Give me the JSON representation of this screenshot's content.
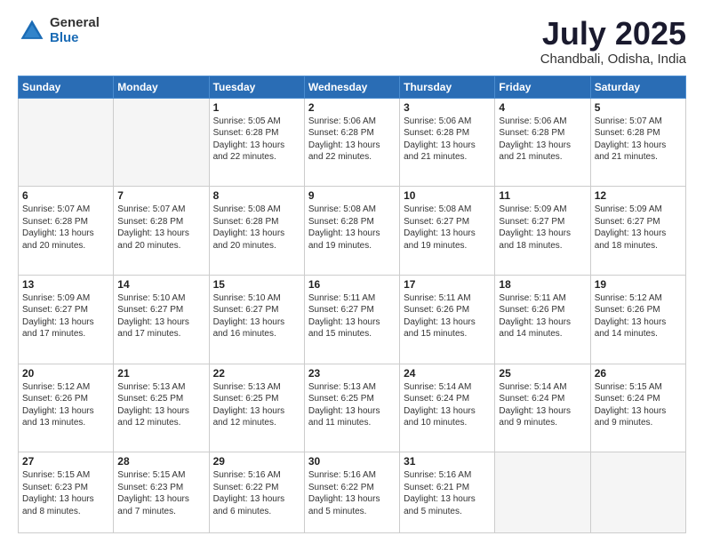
{
  "header": {
    "logo_general": "General",
    "logo_blue": "Blue",
    "month_title": "July 2025",
    "location": "Chandbali, Odisha, India"
  },
  "weekdays": [
    "Sunday",
    "Monday",
    "Tuesday",
    "Wednesday",
    "Thursday",
    "Friday",
    "Saturday"
  ],
  "days": [
    {
      "num": "",
      "empty": true
    },
    {
      "num": "",
      "empty": true
    },
    {
      "num": "1",
      "sunrise": "Sunrise: 5:05 AM",
      "sunset": "Sunset: 6:28 PM",
      "daylight": "Daylight: 13 hours and 22 minutes."
    },
    {
      "num": "2",
      "sunrise": "Sunrise: 5:06 AM",
      "sunset": "Sunset: 6:28 PM",
      "daylight": "Daylight: 13 hours and 22 minutes."
    },
    {
      "num": "3",
      "sunrise": "Sunrise: 5:06 AM",
      "sunset": "Sunset: 6:28 PM",
      "daylight": "Daylight: 13 hours and 21 minutes."
    },
    {
      "num": "4",
      "sunrise": "Sunrise: 5:06 AM",
      "sunset": "Sunset: 6:28 PM",
      "daylight": "Daylight: 13 hours and 21 minutes."
    },
    {
      "num": "5",
      "sunrise": "Sunrise: 5:07 AM",
      "sunset": "Sunset: 6:28 PM",
      "daylight": "Daylight: 13 hours and 21 minutes."
    },
    {
      "num": "6",
      "sunrise": "Sunrise: 5:07 AM",
      "sunset": "Sunset: 6:28 PM",
      "daylight": "Daylight: 13 hours and 20 minutes."
    },
    {
      "num": "7",
      "sunrise": "Sunrise: 5:07 AM",
      "sunset": "Sunset: 6:28 PM",
      "daylight": "Daylight: 13 hours and 20 minutes."
    },
    {
      "num": "8",
      "sunrise": "Sunrise: 5:08 AM",
      "sunset": "Sunset: 6:28 PM",
      "daylight": "Daylight: 13 hours and 20 minutes."
    },
    {
      "num": "9",
      "sunrise": "Sunrise: 5:08 AM",
      "sunset": "Sunset: 6:28 PM",
      "daylight": "Daylight: 13 hours and 19 minutes."
    },
    {
      "num": "10",
      "sunrise": "Sunrise: 5:08 AM",
      "sunset": "Sunset: 6:27 PM",
      "daylight": "Daylight: 13 hours and 19 minutes."
    },
    {
      "num": "11",
      "sunrise": "Sunrise: 5:09 AM",
      "sunset": "Sunset: 6:27 PM",
      "daylight": "Daylight: 13 hours and 18 minutes."
    },
    {
      "num": "12",
      "sunrise": "Sunrise: 5:09 AM",
      "sunset": "Sunset: 6:27 PM",
      "daylight": "Daylight: 13 hours and 18 minutes."
    },
    {
      "num": "13",
      "sunrise": "Sunrise: 5:09 AM",
      "sunset": "Sunset: 6:27 PM",
      "daylight": "Daylight: 13 hours and 17 minutes."
    },
    {
      "num": "14",
      "sunrise": "Sunrise: 5:10 AM",
      "sunset": "Sunset: 6:27 PM",
      "daylight": "Daylight: 13 hours and 17 minutes."
    },
    {
      "num": "15",
      "sunrise": "Sunrise: 5:10 AM",
      "sunset": "Sunset: 6:27 PM",
      "daylight": "Daylight: 13 hours and 16 minutes."
    },
    {
      "num": "16",
      "sunrise": "Sunrise: 5:11 AM",
      "sunset": "Sunset: 6:27 PM",
      "daylight": "Daylight: 13 hours and 15 minutes."
    },
    {
      "num": "17",
      "sunrise": "Sunrise: 5:11 AM",
      "sunset": "Sunset: 6:26 PM",
      "daylight": "Daylight: 13 hours and 15 minutes."
    },
    {
      "num": "18",
      "sunrise": "Sunrise: 5:11 AM",
      "sunset": "Sunset: 6:26 PM",
      "daylight": "Daylight: 13 hours and 14 minutes."
    },
    {
      "num": "19",
      "sunrise": "Sunrise: 5:12 AM",
      "sunset": "Sunset: 6:26 PM",
      "daylight": "Daylight: 13 hours and 14 minutes."
    },
    {
      "num": "20",
      "sunrise": "Sunrise: 5:12 AM",
      "sunset": "Sunset: 6:26 PM",
      "daylight": "Daylight: 13 hours and 13 minutes."
    },
    {
      "num": "21",
      "sunrise": "Sunrise: 5:13 AM",
      "sunset": "Sunset: 6:25 PM",
      "daylight": "Daylight: 13 hours and 12 minutes."
    },
    {
      "num": "22",
      "sunrise": "Sunrise: 5:13 AM",
      "sunset": "Sunset: 6:25 PM",
      "daylight": "Daylight: 13 hours and 12 minutes."
    },
    {
      "num": "23",
      "sunrise": "Sunrise: 5:13 AM",
      "sunset": "Sunset: 6:25 PM",
      "daylight": "Daylight: 13 hours and 11 minutes."
    },
    {
      "num": "24",
      "sunrise": "Sunrise: 5:14 AM",
      "sunset": "Sunset: 6:24 PM",
      "daylight": "Daylight: 13 hours and 10 minutes."
    },
    {
      "num": "25",
      "sunrise": "Sunrise: 5:14 AM",
      "sunset": "Sunset: 6:24 PM",
      "daylight": "Daylight: 13 hours and 9 minutes."
    },
    {
      "num": "26",
      "sunrise": "Sunrise: 5:15 AM",
      "sunset": "Sunset: 6:24 PM",
      "daylight": "Daylight: 13 hours and 9 minutes."
    },
    {
      "num": "27",
      "sunrise": "Sunrise: 5:15 AM",
      "sunset": "Sunset: 6:23 PM",
      "daylight": "Daylight: 13 hours and 8 minutes."
    },
    {
      "num": "28",
      "sunrise": "Sunrise: 5:15 AM",
      "sunset": "Sunset: 6:23 PM",
      "daylight": "Daylight: 13 hours and 7 minutes."
    },
    {
      "num": "29",
      "sunrise": "Sunrise: 5:16 AM",
      "sunset": "Sunset: 6:22 PM",
      "daylight": "Daylight: 13 hours and 6 minutes."
    },
    {
      "num": "30",
      "sunrise": "Sunrise: 5:16 AM",
      "sunset": "Sunset: 6:22 PM",
      "daylight": "Daylight: 13 hours and 5 minutes."
    },
    {
      "num": "31",
      "sunrise": "Sunrise: 5:16 AM",
      "sunset": "Sunset: 6:21 PM",
      "daylight": "Daylight: 13 hours and 5 minutes."
    },
    {
      "num": "",
      "empty": true
    },
    {
      "num": "",
      "empty": true
    }
  ]
}
